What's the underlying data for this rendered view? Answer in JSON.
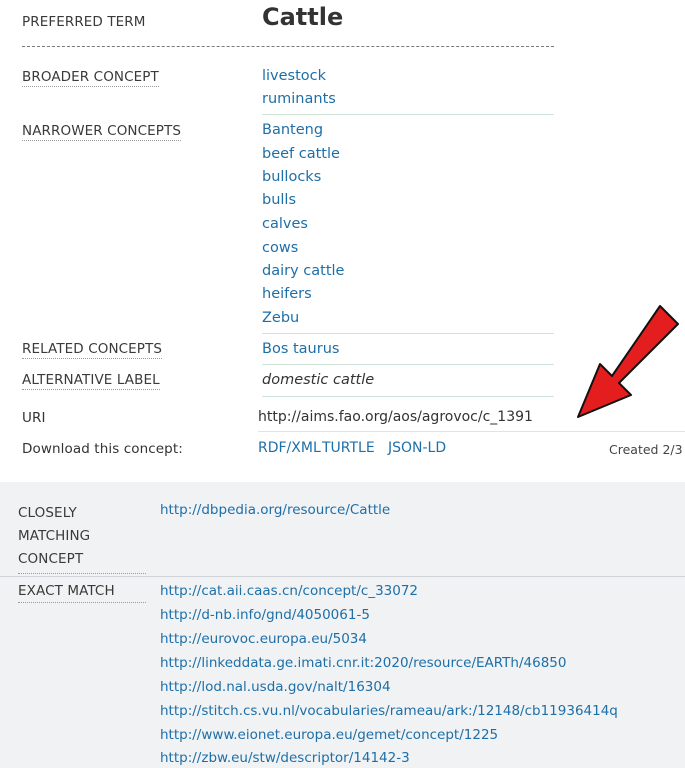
{
  "preferred_term": {
    "label": "PREFERRED TERM",
    "value": "Cattle"
  },
  "broader": {
    "label": "BROADER CONCEPT",
    "items": [
      "livestock",
      "ruminants"
    ]
  },
  "narrower": {
    "label": "NARROWER CONCEPTS",
    "items": [
      "Banteng",
      "beef cattle",
      "bullocks",
      "bulls",
      "calves",
      "cows",
      "dairy cattle",
      "heifers",
      "Zebu"
    ]
  },
  "related": {
    "label": "RELATED CONCEPTS",
    "items": [
      "Bos taurus"
    ]
  },
  "alternative": {
    "label": "ALTERNATIVE LABEL",
    "value": "domestic cattle"
  },
  "uri": {
    "label": "URI",
    "value": "http://aims.fao.org/aos/agrovoc/c_1391"
  },
  "download": {
    "label": "Download this concept:",
    "formats": [
      "RDF/XML",
      "TURTLE",
      "JSON-LD"
    ],
    "created": "Created 2/3"
  },
  "closely_matching": {
    "label_lines": [
      "CLOSELY",
      "MATCHING",
      "CONCEPT"
    ],
    "items": [
      "http://dbpedia.org/resource/Cattle"
    ]
  },
  "exact_match": {
    "label": "EXACT MATCH",
    "items": [
      "http://cat.aii.caas.cn/concept/c_33072",
      "http://d-nb.info/gnd/4050061-5",
      "http://eurovoc.europa.eu/5034",
      "http://linkeddata.ge.imati.cnr.it:2020/resource/EARTh/46850",
      "http://lod.nal.usda.gov/nalt/16304",
      "http://stitch.cs.vu.nl/vocabularies/rameau/ark:/12148/cb11936414q",
      "http://www.eionet.europa.eu/gemet/concept/1225",
      "http://zbw.eu/stw/descriptor/14142-3"
    ]
  },
  "colors": {
    "link": "#1e6fa8",
    "arrow": "#e41e1e",
    "panel_bg": "#f0f2f4"
  }
}
